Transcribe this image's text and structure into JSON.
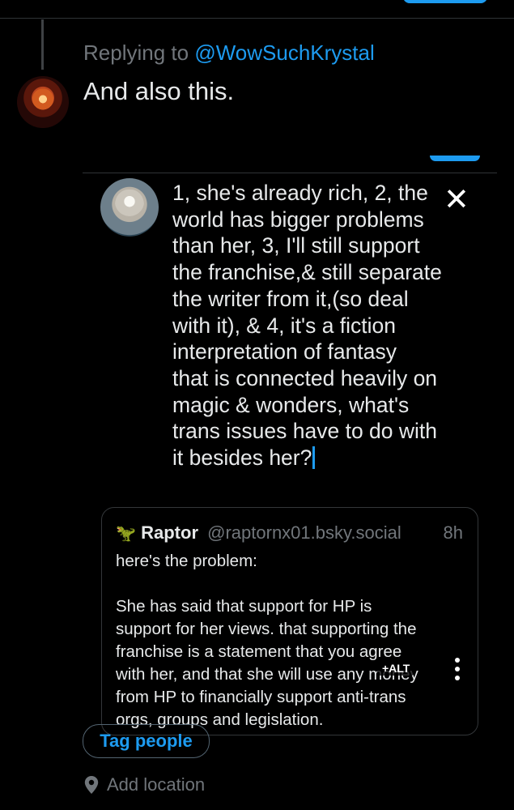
{
  "reply": {
    "replying_prefix": "Replying to",
    "replying_handle": "@WowSuchKrystal",
    "text": "And also this."
  },
  "composer": {
    "text_lines": [
      "1, she's already rich, 2, the",
      "world has bigger problems",
      "than her, 3, I'll still support",
      "the franchise,& still separate",
      "the writer from it,(so deal",
      "with it), & 4, it's a fiction",
      "interpretation of fantasy",
      "that is connected heavily on",
      "magic & wonders, what's",
      "trans issues have to do with",
      "it besides her?"
    ],
    "close_glyph": "✕"
  },
  "quote": {
    "avatar_glyph": "🦖",
    "name": "Raptor",
    "handle": "@raptornx01.bsky.social",
    "time": "8h",
    "lines": [
      "here's the problem:",
      "",
      "She has said that support for HP is",
      "support for her views. that supporting the",
      "franchise is a statement that you agree",
      "with her, and that she will use any money",
      "from HP to financially support anti-trans",
      "orgs, groups and legislation."
    ]
  },
  "image_controls": {
    "alt_label": "+ALT"
  },
  "actions": {
    "tag_people": "Tag people",
    "add_location": "Add location"
  },
  "colors": {
    "accent": "#1d9bf0",
    "muted": "#71767b",
    "background": "#000000"
  }
}
